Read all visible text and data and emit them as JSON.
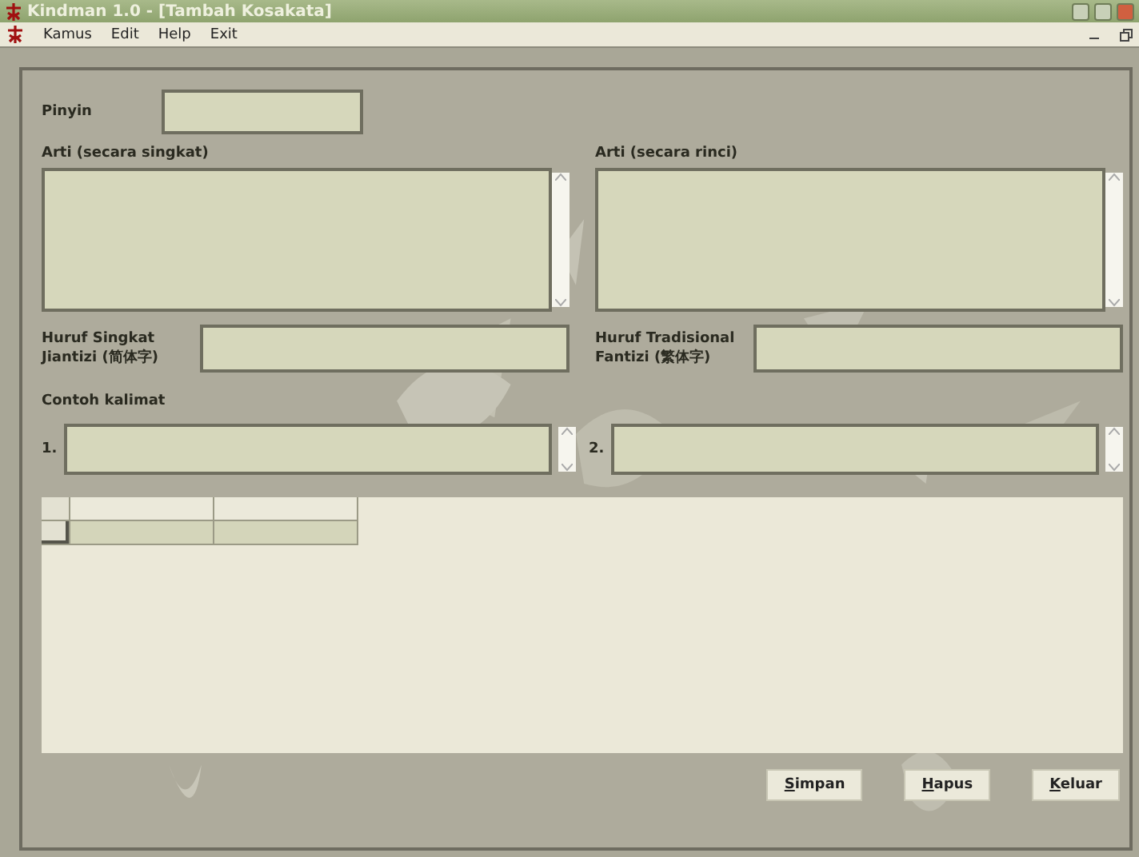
{
  "window": {
    "title": "Kindman 1.0 - [Tambah Kosakata]"
  },
  "menu": [
    "Kamus",
    "Edit",
    "Help",
    "Exit"
  ],
  "form": {
    "pinyin_label": "Pinyin",
    "short_meaning_label": "Arti  (secara singkat)",
    "long_meaning_label": "Arti  (secara rinci)",
    "simplified_label": [
      "Huruf Singkat",
      "Jiantizi (简体字)"
    ],
    "traditional_label": [
      "Huruf Tradisional",
      "Fantizi (繁体字)"
    ],
    "examples_label": "Contoh kalimat",
    "examples": [
      {
        "number": "1."
      },
      {
        "number": "2."
      }
    ]
  },
  "grid": {
    "rows": [
      {
        "selected": false
      },
      {
        "selected": true
      }
    ]
  },
  "buttons": [
    "Simpan",
    "Hapus",
    "Keluar"
  ]
}
